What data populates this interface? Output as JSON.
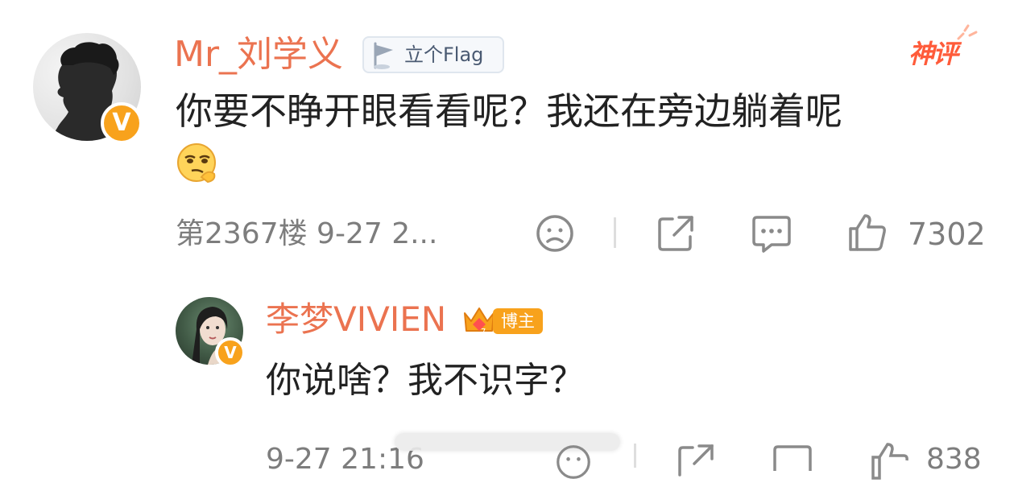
{
  "main_comment": {
    "username": "Mr_刘学义",
    "badge_label": "立个Flag",
    "tag": "神评",
    "text": "你要不睁开眼看看呢？我还在旁边躺着呢",
    "emoji": "smirk-emoji",
    "floor_time": "第2367楼 9-27 2...",
    "like_count": "7302"
  },
  "reply": {
    "username": "李梦VIVIEN",
    "badge_label": "博主",
    "text": "你说啥？我不识字？",
    "time": "9-27 21:16",
    "like_count": "838"
  },
  "colors": {
    "username": "#eb7350",
    "verified": "#f8a21c",
    "tag": "#ff5b3a",
    "icon": "#8a8a8a"
  },
  "icons": [
    "dislike-icon",
    "share-icon",
    "comment-icon",
    "like-icon",
    "flag-icon",
    "crown-icon",
    "verified-icon"
  ]
}
